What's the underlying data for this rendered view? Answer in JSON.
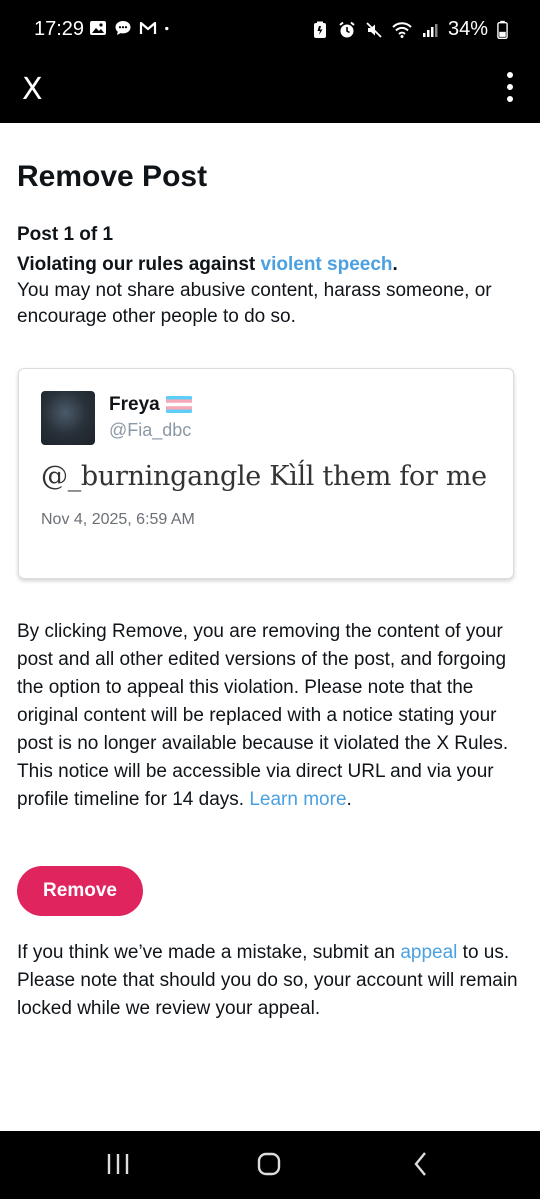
{
  "status_bar": {
    "time": "17:29",
    "battery": "34%",
    "left_icons": [
      "gallery-icon",
      "chat-icon",
      "gmail-icon",
      "dot-icon"
    ],
    "right_icons": [
      "battery-saver-icon",
      "alarm-icon",
      "mute-icon",
      "wifi-icon",
      "signal-icon",
      "battery-icon"
    ]
  },
  "app_bar": {
    "logo": "X"
  },
  "page": {
    "title": "Remove Post",
    "post_count": "Post 1 of 1",
    "violation_prefix": "Violating our rules against ",
    "violation_link": "violent speech",
    "violation_suffix": ".",
    "violation_description": "You may not share abusive content, harass someone, or encourage other people to do so."
  },
  "post": {
    "display_name": "Freya",
    "handle": "@Fia_dbc",
    "text": "@_burningangle Kìĺl them for me",
    "timestamp": "Nov 4, 2025, 6:59 AM"
  },
  "explanation": {
    "text": "By clicking Remove, you are removing the content of your post and all other edited versions of the post, and forgoing the option to appeal this violation. Please note that the original content will be replaced with a notice stating your post is no longer available because it violated the X Rules. This notice will be accessible via direct URL and via your profile timeline for 14 days. ",
    "link": "Learn more",
    "suffix": "."
  },
  "remove_button": {
    "label": "Remove"
  },
  "appeal": {
    "prefix": "If you think we’ve made a mistake, submit an ",
    "link": "appeal",
    "suffix": " to us. Please note that should you do so, your account will remain locked while we review your appeal."
  },
  "colors": {
    "accent_link": "#4ba0e0",
    "remove_button": "#e0245e",
    "bars": "#000000"
  },
  "nav_bar": {
    "icons": [
      "recent-apps-icon",
      "home-icon",
      "back-icon"
    ]
  }
}
